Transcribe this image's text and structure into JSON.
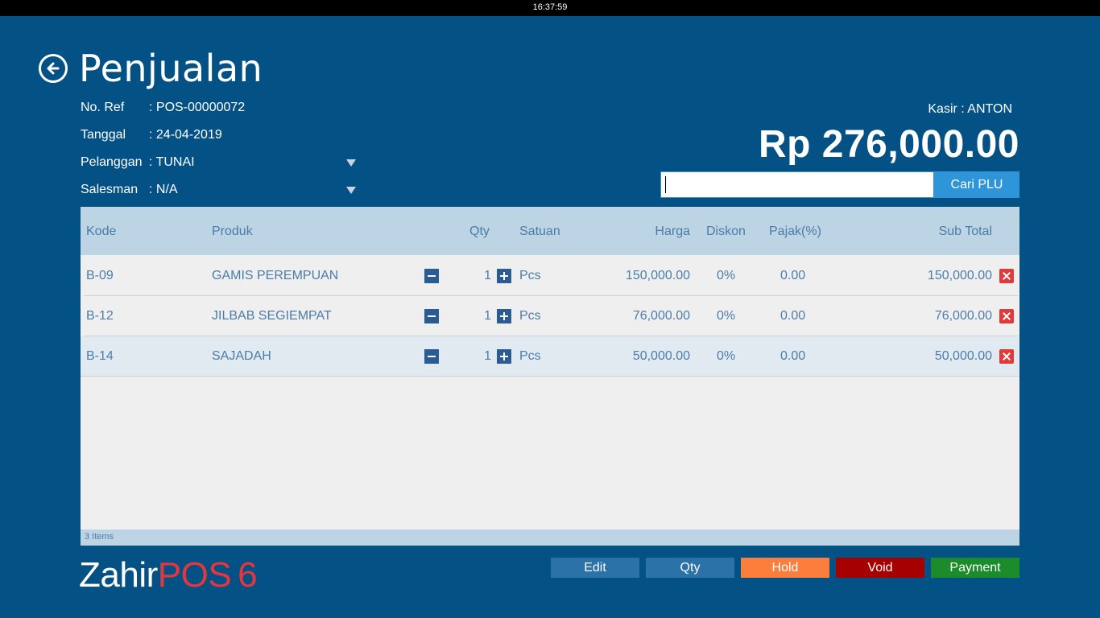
{
  "system": {
    "clock": "16:37:59"
  },
  "page": {
    "title": "Penjualan"
  },
  "info": {
    "no_ref_label": "No. Ref",
    "no_ref_value": ": POS-00000072",
    "tanggal_label": "Tanggal",
    "tanggal_value": ": 24-04-2019",
    "pelanggan_label": "Pelanggan",
    "pelanggan_value": ": TUNAI",
    "salesman_label": "Salesman",
    "salesman_value": ": N/A"
  },
  "kasir": "Kasir : ANTON",
  "total": "Rp 276,000.00",
  "search": {
    "value": "",
    "button_label": "Cari PLU"
  },
  "table": {
    "headers": {
      "kode": "Kode",
      "produk": "Produk",
      "qty": "Qty",
      "satuan": "Satuan",
      "harga": "Harga",
      "diskon": "Diskon",
      "pajak": "Pajak(%)",
      "subtotal": "Sub Total"
    },
    "rows": [
      {
        "kode": "B-09",
        "produk": "GAMIS PEREMPUAN",
        "qty": "1",
        "satuan": "Pcs",
        "harga": "150,000.00",
        "diskon": "0%",
        "pajak": "0.00",
        "subtotal": "150,000.00"
      },
      {
        "kode": "B-12",
        "produk": "JILBAB SEGIEMPAT",
        "qty": "1",
        "satuan": "Pcs",
        "harga": "76,000.00",
        "diskon": "0%",
        "pajak": "0.00",
        "subtotal": "76,000.00"
      },
      {
        "kode": "B-14",
        "produk": "SAJADAH",
        "qty": "1",
        "satuan": "Pcs",
        "harga": "50,000.00",
        "diskon": "0%",
        "pajak": "0.00",
        "subtotal": "50,000.00"
      }
    ],
    "footer": "3 Items"
  },
  "logo": {
    "zahir": "Zahir",
    "pos": "POS",
    "version": "6"
  },
  "actions": {
    "edit": "Edit",
    "qty": "Qty",
    "hold": "Hold",
    "void": "Void",
    "payment": "Payment"
  },
  "colors": {
    "background": "#045185",
    "hold": "#fc7e3c",
    "void": "#a50101",
    "payment": "#1b8b2b",
    "neutral_button": "#2a72a8",
    "delete": "#e13a3a"
  }
}
